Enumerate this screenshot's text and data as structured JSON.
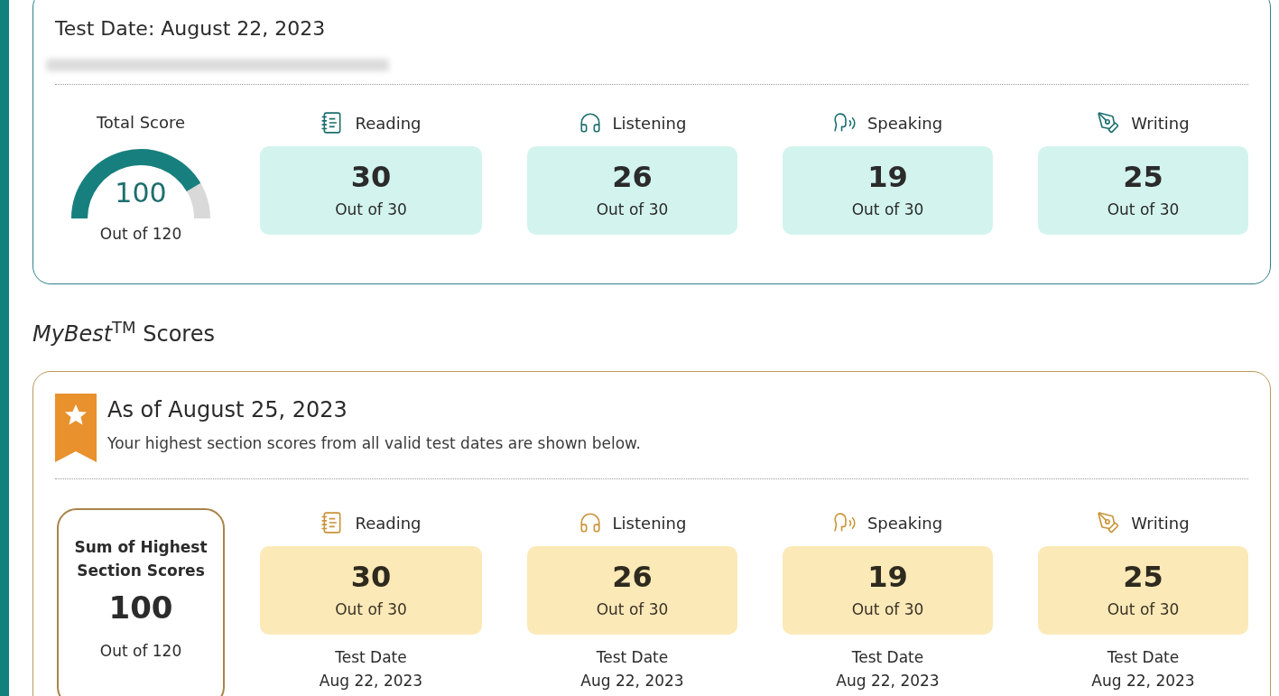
{
  "test_report": {
    "title": "Test Date: August 22, 2023",
    "total": {
      "label": "Total Score",
      "score": "100",
      "out_of": "Out of 120"
    },
    "sections": [
      {
        "kind": "reading",
        "label": "Reading",
        "score": "30",
        "out_of": "Out of 30"
      },
      {
        "kind": "listening",
        "label": "Listening",
        "score": "26",
        "out_of": "Out of 30"
      },
      {
        "kind": "speaking",
        "label": "Speaking",
        "score": "19",
        "out_of": "Out of 30"
      },
      {
        "kind": "writing",
        "label": "Writing",
        "score": "25",
        "out_of": "Out of 30"
      }
    ]
  },
  "mybest": {
    "heading": "*MyBest*$^{TM}$ Scores",
    "as_of": "As of August 25, 2023",
    "description": "Your highest section scores from all valid test dates are shown below.",
    "sum": {
      "label": "Sum of Highest Section Scores",
      "score": "100",
      "out_of": "Out of 120"
    },
    "sections": [
      {
        "kind": "reading",
        "label": "Reading",
        "score": "30",
        "out_of": "Out of 30",
        "date_label": "Test Date",
        "date": "Aug 22, 2023"
      },
      {
        "kind": "listening",
        "label": "Listening",
        "score": "26",
        "out_of": "Out of 30",
        "date_label": "Test Date",
        "date": "Aug 22, 2023"
      },
      {
        "kind": "speaking",
        "label": "Speaking",
        "score": "19",
        "out_of": "Out of 30",
        "date_label": "Test Date",
        "date": "Aug 22, 2023"
      },
      {
        "kind": "writing",
        "label": "Writing",
        "score": "25",
        "out_of": "Out of 30",
        "date_label": "Test Date",
        "date": "Aug 22, 2023"
      }
    ]
  }
}
